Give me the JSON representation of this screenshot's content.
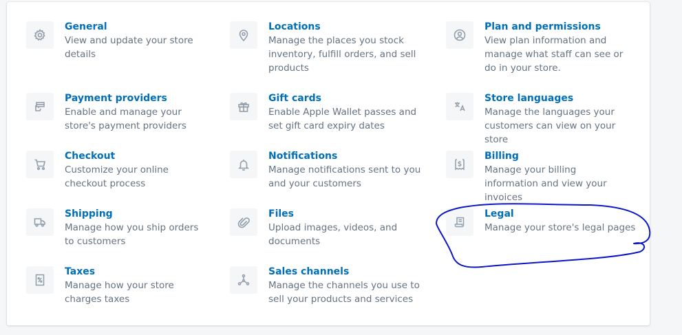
{
  "settings": {
    "items": [
      {
        "key": "general",
        "title": "General",
        "description": "View and update your store details",
        "icon": "gear-icon"
      },
      {
        "key": "locations",
        "title": "Locations",
        "description": "Manage the places you stock inventory, fulfill orders, and sell products",
        "icon": "location-pin-icon"
      },
      {
        "key": "plan",
        "title": "Plan and permissions",
        "description": "View plan information and manage what staff can see or do in your store.",
        "icon": "user-circle-icon"
      },
      {
        "key": "payments",
        "title": "Payment providers",
        "description": "Enable and manage your store's payment providers",
        "icon": "payment-icon"
      },
      {
        "key": "giftcards",
        "title": "Gift cards",
        "description": "Enable Apple Wallet passes and set gift card expiry dates",
        "icon": "gift-icon"
      },
      {
        "key": "languages",
        "title": "Store languages",
        "description": "Manage the languages your customers can view on your store",
        "icon": "translate-icon"
      },
      {
        "key": "checkout",
        "title": "Checkout",
        "description": "Customize your online checkout process",
        "icon": "cart-icon"
      },
      {
        "key": "notifications",
        "title": "Notifications",
        "description": "Manage notifications sent to you and your customers",
        "icon": "bell-icon"
      },
      {
        "key": "billing",
        "title": "Billing",
        "description": "Manage your billing information and view your invoices",
        "icon": "receipt-dollar-icon"
      },
      {
        "key": "shipping",
        "title": "Shipping",
        "description": "Manage how you ship orders to customers",
        "icon": "truck-icon"
      },
      {
        "key": "files",
        "title": "Files",
        "description": "Upload images, videos, and documents",
        "icon": "paperclip-icon"
      },
      {
        "key": "legal",
        "title": "Legal",
        "description": "Manage your store's legal pages",
        "icon": "scroll-icon"
      },
      {
        "key": "taxes",
        "title": "Taxes",
        "description": "Manage how your store charges taxes",
        "icon": "tax-icon"
      },
      {
        "key": "saleschannels",
        "title": "Sales channels",
        "description": "Manage the channels you use to sell your products and services",
        "icon": "channels-icon"
      }
    ]
  },
  "colors": {
    "link": "#006fbb",
    "subdued": "#637381",
    "icon": "#919eab",
    "annotation": "#0a16c8"
  }
}
